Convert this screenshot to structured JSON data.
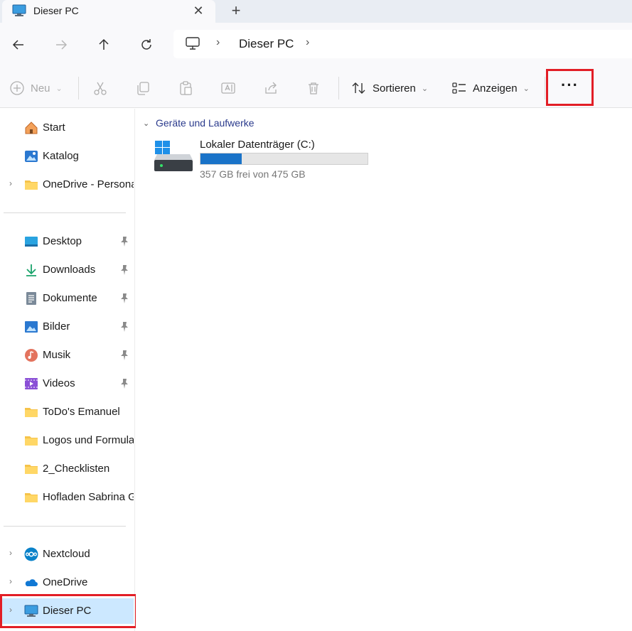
{
  "tab": {
    "title": "Dieser PC",
    "close_symbol": "✕",
    "new_symbol": "+"
  },
  "address": {
    "crumb": "Dieser PC"
  },
  "toolbar": {
    "new_label": "Neu",
    "sort_label": "Sortieren",
    "view_label": "Anzeigen",
    "more_label": "···"
  },
  "sidebar": {
    "top": [
      {
        "label": "Start",
        "icon": "home-icon"
      },
      {
        "label": "Katalog",
        "icon": "gallery-icon"
      },
      {
        "label": "OneDrive - Persona",
        "icon": "folder-icon"
      }
    ],
    "pinned": [
      {
        "label": "Desktop",
        "icon": "desktop-icon"
      },
      {
        "label": "Downloads",
        "icon": "download-icon"
      },
      {
        "label": "Dokumente",
        "icon": "document-icon"
      },
      {
        "label": "Bilder",
        "icon": "pictures-icon"
      },
      {
        "label": "Musik",
        "icon": "music-icon"
      },
      {
        "label": "Videos",
        "icon": "videos-icon"
      },
      {
        "label": "ToDo's Emanuel",
        "icon": "folder-icon"
      },
      {
        "label": "Logos und Formula",
        "icon": "folder-icon"
      },
      {
        "label": "2_Checklisten",
        "icon": "folder-icon"
      },
      {
        "label": "Hofladen Sabrina G",
        "icon": "folder-icon"
      }
    ],
    "bottom": [
      {
        "label": "Nextcloud",
        "icon": "nextcloud-icon"
      },
      {
        "label": "OneDrive",
        "icon": "onedrive-icon"
      },
      {
        "label": "Dieser PC",
        "icon": "this-pc-icon"
      }
    ]
  },
  "content": {
    "group_label": "Geräte und Laufwerke",
    "drives": [
      {
        "name": "Lokaler Datenträger (C:)",
        "free_text": "357 GB frei von 475 GB",
        "used_fraction": 0.248
      }
    ]
  },
  "colors": {
    "accent": "#1a73c8",
    "selection": "#cce8ff",
    "highlight_box": "#e21e26"
  }
}
